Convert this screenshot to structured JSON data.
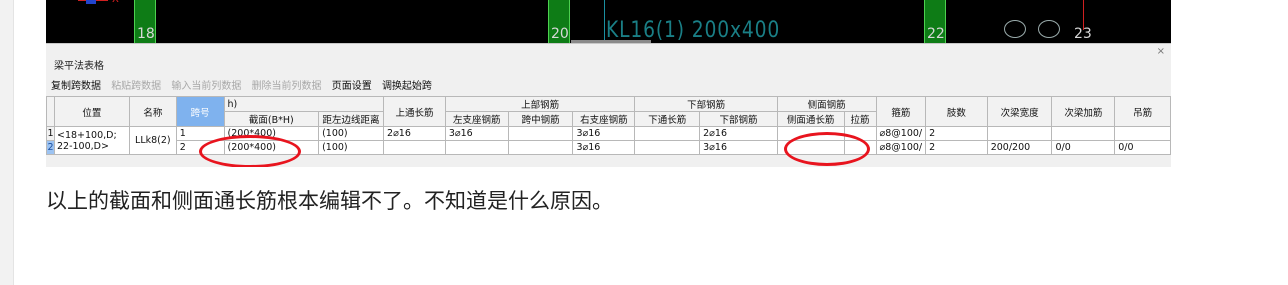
{
  "cad": {
    "axis_numbers": [
      "18",
      "20",
      "22",
      "23"
    ],
    "beam_label": "KL16(1) 200x400",
    "coord_label": "X"
  },
  "panel": {
    "title": "梁平法表格",
    "close": "×",
    "toolbar": [
      {
        "label": "复制跨数据",
        "enabled": true
      },
      {
        "label": "粘贴跨数据",
        "enabled": false
      },
      {
        "label": "输入当前列数据",
        "enabled": false
      },
      {
        "label": "删除当前列数据",
        "enabled": false
      },
      {
        "label": "页面设置",
        "enabled": true
      },
      {
        "label": "调换起始跨",
        "enabled": true
      }
    ]
  },
  "table": {
    "headers": {
      "position": "位置",
      "name": "名称",
      "span": "跨号",
      "elev_suffix": "h)",
      "section": "截面(B*H)",
      "edge_dist": "距左边线距离",
      "top_through": "上通长筋",
      "top_group": "上部钢筋",
      "left_seat": "左支座钢筋",
      "mid_span": "跨中钢筋",
      "right_seat": "右支座钢筋",
      "bottom_group": "下部钢筋",
      "bottom_through": "下通长筋",
      "bottom_rebar": "下部钢筋",
      "side_group": "侧面钢筋",
      "side_through": "侧面通长筋",
      "tie": "拉筋",
      "stirrup": "箍筋",
      "legs": "肢数",
      "sec_width": "次梁宽度",
      "sec_add": "次梁加筋",
      "hanger": "吊筋"
    },
    "row_numbers": [
      "1",
      "2"
    ],
    "position_value": [
      "<18+100,D;",
      "22-100,D>"
    ],
    "name_value": "LLk8(2)",
    "rows": [
      {
        "span": "1",
        "section": "(200*400)",
        "edge": "(100)",
        "top_through": "2⌀16",
        "left_seat": "3⌀16",
        "mid": "",
        "right_seat": "3⌀16",
        "bottom_through": "",
        "bottom": "2⌀16",
        "side_through": "",
        "tie": "",
        "stirrup": "⌀8@100/",
        "legs": "2",
        "sec_width": "",
        "sec_add": "",
        "hanger": ""
      },
      {
        "span": "2",
        "section": "(200*400)",
        "edge": "(100)",
        "top_through": "",
        "left_seat": "",
        "mid": "",
        "right_seat": "3⌀16",
        "bottom_through": "",
        "bottom": "3⌀16",
        "side_through": "",
        "tie": "",
        "stirrup": "⌀8@100/",
        "legs": "2",
        "sec_width": "200/200",
        "sec_add": "0/0",
        "hanger": "0/0"
      }
    ]
  },
  "caption": "以上的截面和侧面通长筋根本编辑不了。不知道是什么原因。",
  "colors": {
    "annotation": "#e8141e",
    "selected_header": "#7fb2ee",
    "cad_column": "#0e7c16"
  }
}
